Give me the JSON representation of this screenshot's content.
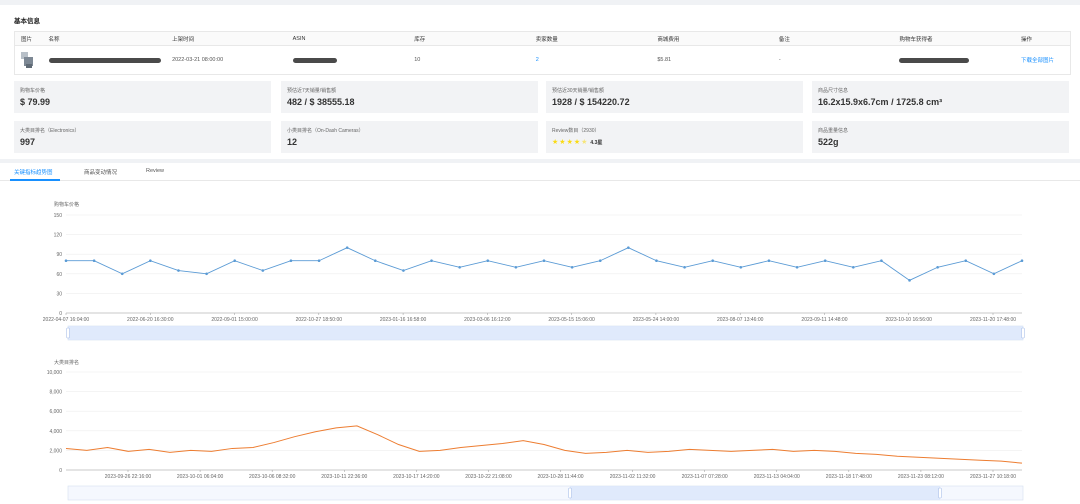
{
  "section_title": "基本信息",
  "table": {
    "headers": [
      "图片",
      "名称",
      "上架时间",
      "ASIN",
      "库存",
      "卖家数量",
      "商城费用",
      "备注",
      "购物车获得者",
      "操作"
    ],
    "row": {
      "launch_time": "2022-03-21 08:00:00",
      "stock": "10",
      "sellers": "2",
      "fee": "$5.81",
      "remark": "-",
      "action": "下载全部图片"
    }
  },
  "stats": [
    {
      "label": "购物车价格",
      "value": "$ 79.99"
    },
    {
      "label": "预估近7天销量/销售额",
      "value": "482 / $ 38555.18"
    },
    {
      "label": "预估近30天销量/销售额",
      "value": "1928 / $ 154220.72"
    },
    {
      "label": "商品尺寸信息",
      "value": "16.2x15.9x6.7cm / 1725.8 cm³"
    },
    {
      "label": "大类目排名（Electronics）",
      "value": "997"
    },
    {
      "label": "小类目排名（On-Dash Cameras）",
      "value": "12"
    },
    {
      "label": "Review数目（2930）",
      "value": "4.3星",
      "rating": 4.3
    },
    {
      "label": "商品重量信息",
      "value": "522g"
    }
  ],
  "tabs": [
    "关键指标趋势图",
    "商品变动情况",
    "Review"
  ],
  "chart_data": [
    {
      "type": "line",
      "ylabel": "购物车价格",
      "ylim": [
        0,
        150
      ],
      "yticks": [
        0,
        30,
        60,
        90,
        120,
        150
      ],
      "xticks": [
        "2022-04-07 16:04:00",
        "2022-06-20 16:30:00",
        "2022-09-01 15:00:00",
        "2022-10-27 18:50:00",
        "2023-01-16 16:58:00",
        "2023-03-06 16:12:00",
        "2023-05-15 15:06:00",
        "2023-05-24 14:00:00",
        "2023-08-07 13:46:00",
        "2023-09-11 14:48:00",
        "2023-10-10 16:56:00",
        "2023-11-20 17:48:00"
      ],
      "values": [
        80,
        80,
        60,
        80,
        65,
        60,
        80,
        65,
        80,
        80,
        100,
        80,
        65,
        80,
        70,
        80,
        70,
        80,
        70,
        80,
        100,
        80,
        70,
        80,
        70,
        80,
        70,
        80,
        70,
        80,
        50,
        70,
        80,
        60,
        80
      ],
      "color": "#5b9bd5"
    },
    {
      "type": "line",
      "ylabel": "大类目排名",
      "ylim": [
        0,
        10000
      ],
      "yticks": [
        "0",
        "2,000",
        "4,000",
        "6,000",
        "8,000",
        "10,000"
      ],
      "xticks": [
        "2023-09-26 22:16:00",
        "2023-10-01 06:04:00",
        "2023-10-06 08:32:00",
        "2023-10-11 22:36:00",
        "2023-10-17 14:20:00",
        "2023-10-22 21:08:00",
        "2023-10-28 11:44:00",
        "2023-11-02 11:32:00",
        "2023-11-07 07:28:00",
        "2023-11-13 04:04:00",
        "2023-11-18 17:48:00",
        "2023-11-23 08:12:00",
        "2023-11-27 10:18:00"
      ],
      "values": [
        2200,
        2000,
        2300,
        1900,
        2100,
        1800,
        2000,
        1900,
        2200,
        2300,
        2800,
        3400,
        3900,
        4300,
        4500,
        3600,
        2600,
        1900,
        2000,
        2300,
        2500,
        2700,
        3000,
        2600,
        2000,
        1700,
        1800,
        2000,
        1800,
        1900,
        2100,
        2000,
        1900,
        2000,
        2100,
        1900,
        2000,
        1900,
        1700,
        1600,
        1400,
        1300,
        1200,
        1100,
        1000,
        900,
        700
      ],
      "color": "#ed7d31"
    }
  ]
}
